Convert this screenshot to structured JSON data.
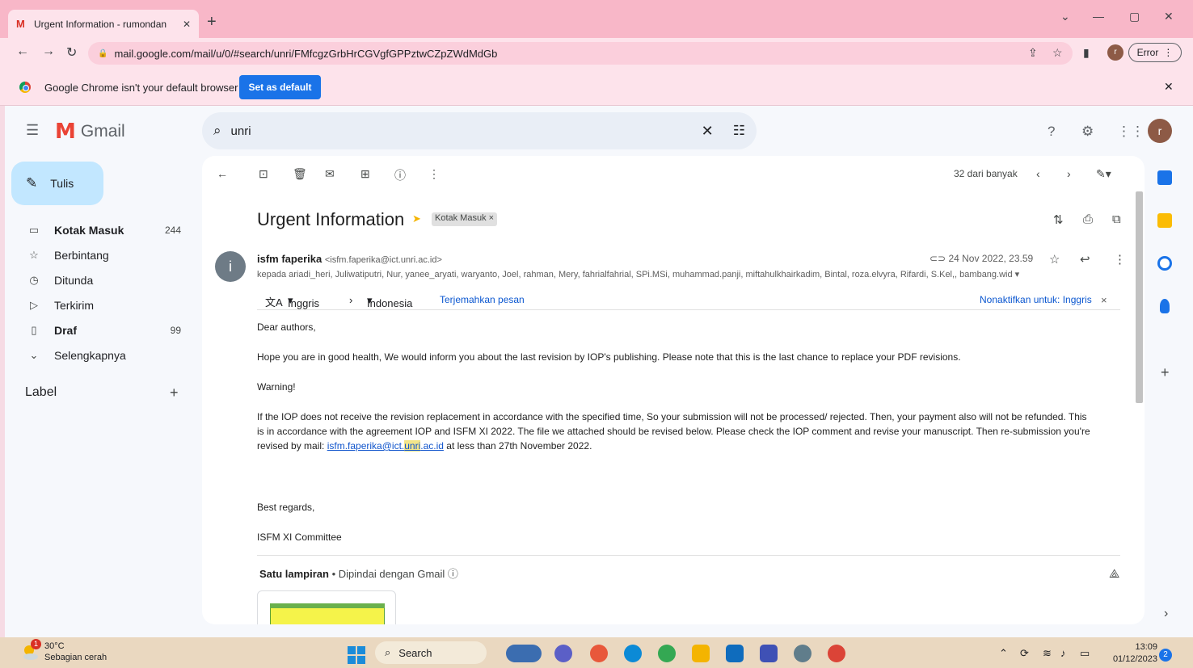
{
  "browser": {
    "tab_title": "Urgent Information - rumondan",
    "tab_favicon": "M",
    "new_tab": "+",
    "url": "mail.google.com/mail/u/0/#search/unri/FMfcgzGrbHrCGVgfGPPztwCZpZWdMdGb",
    "profile_initial": "r",
    "error_label": "Error",
    "infobar_message": "Google Chrome isn't your default browser",
    "set_default_label": "Set as default"
  },
  "gmail": {
    "logo_text": "Gmail",
    "search_value": "unri",
    "account_initial": "r",
    "compose_label": "Tulis",
    "nav": [
      {
        "icon": "inbox-icon",
        "label": "Kotak Masuk",
        "count": "244",
        "bold": true
      },
      {
        "icon": "star-icon",
        "label": "Berbintang",
        "count": "",
        "bold": false
      },
      {
        "icon": "clock-icon",
        "label": "Ditunda",
        "count": "",
        "bold": false
      },
      {
        "icon": "send-icon",
        "label": "Terkirim",
        "count": "",
        "bold": false
      },
      {
        "icon": "draft-icon",
        "label": "Draf",
        "count": "99",
        "bold": true
      },
      {
        "icon": "chevron-down-icon",
        "label": "Selengkapnya",
        "count": "",
        "bold": false
      }
    ],
    "labels_header": "Label",
    "counter": "32 dari banyak"
  },
  "message": {
    "subject": "Urgent Information",
    "label_chip": "Kotak Masuk",
    "sender_name": "isfm faperika",
    "sender_email": "<isfm.faperika@ict.unri.ac.id>",
    "recipients": "kepada ariadi_heri, Juliwatiputri, Nur, yanee_aryati, waryanto, Joel, rahman, Mery, fahrialfahrial, SPi.MSi, muhammad.panji, miftahulkhairkadim, Bintal, roza.elvyra, Rifardi, S.Kel,, bambang.wid",
    "date": "24 Nov 2022, 23.59",
    "avatar_initial": "i",
    "translate": {
      "from_lang": "Inggris",
      "to_lang": "Indonesia",
      "translate_link": "Terjemahkan pesan",
      "disable_link": "Nonaktifkan untuk: Inggris"
    },
    "body": {
      "greeting": "Dear authors,",
      "p1": "Hope you are in good health, We would inform you about the last revision by IOP's publishing. Please note that this is the last chance to replace your  PDF revisions.",
      "warning": "Warning!",
      "p2a": "If the IOP does not receive the revision replacement in accordance with the specified time, So your submission will not be processed/ rejected. Then, your payment also will not be refunded. This",
      "p2b": "is in accordance with the agreement IOP and ISFM XI 2022. The file we attached should be revised below. Please check the IOP comment and revise your manuscript. Then re-submission you're",
      "p2c_pre": "revised by mail: ",
      "mail_pre": "isfm.faperika@ict.",
      "mail_hl": "unri",
      "mail_post": ".ac.id",
      "p2c_post": " at less than 27th November 2022.",
      "regards": "Best regards,",
      "signature": "ISFM XI Committee"
    },
    "attachment_title": "Satu lampiran",
    "attachment_sub": "Dipindai dengan Gmail"
  },
  "taskbar": {
    "temperature": "30°C",
    "weather": "Sebagian cerah",
    "weather_badge": "1",
    "search_label": "Search",
    "time": "13:09",
    "date": "01/12/2023",
    "notifications": "2"
  }
}
